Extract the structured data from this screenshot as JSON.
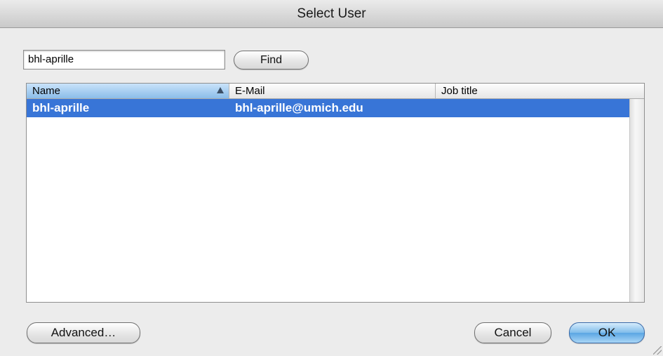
{
  "window": {
    "title": "Select User"
  },
  "search": {
    "value": "bhl-aprille",
    "find_label": "Find"
  },
  "table": {
    "columns": [
      "Name",
      "E-Mail",
      "Job title"
    ],
    "sort_column": "Name",
    "sort_direction": "ascending",
    "rows": [
      {
        "name": "bhl-aprille",
        "email": "bhl-aprille@umich.edu",
        "job_title": "",
        "selected": true
      }
    ]
  },
  "buttons": {
    "advanced": "Advanced…",
    "cancel": "Cancel",
    "ok": "OK"
  },
  "colors": {
    "selection": "#3875d7",
    "default_button": "#5aa6e3",
    "window_bg": "#ececec"
  }
}
